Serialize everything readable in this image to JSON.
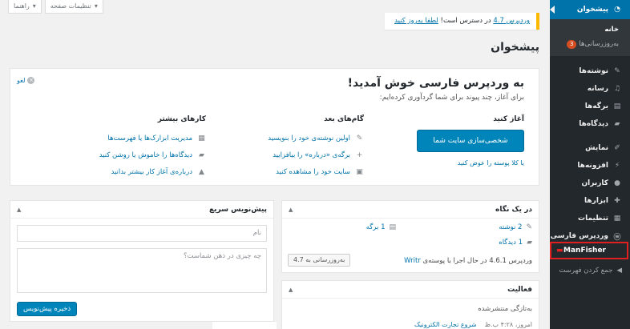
{
  "menu": {
    "dashboard": "پیشخوان",
    "home": "خانه",
    "updates": "به‌روزرسانی‌ها",
    "updates_count": "3",
    "posts": "نوشته‌ها",
    "media": "رسانه",
    "pages": "برگه‌ها",
    "comments": "دیدگاه‌ها",
    "appearance": "نمایش",
    "plugins": "افزونه‌ها",
    "users": "کاربران",
    "tools": "ابزارها",
    "settings": "تنظیمات",
    "persian": "وردپرس فارسی",
    "manfisher": "ManFisher",
    "collapse": "جمع کردن فهرست"
  },
  "tabs": {
    "screen_options": "تنظیمات صفحه",
    "help": "راهنما"
  },
  "notice": {
    "link1": "وردپرس 4.7",
    "text": " در دسترس است! ",
    "link2": "لطفا به‌روز کنید"
  },
  "page_title": "پیشخوان",
  "welcome": {
    "title": "به وردپرس فارسی خوش آمدید!",
    "subtitle": "برای آغاز، چند پیوند برای شما گردآوری کرده‌ایم:",
    "dismiss": "لغو",
    "start_title": "آغاز کنید",
    "customize_btn": "شخصی‌سازی سایت شما",
    "or_change": "یا کلا پوسته را عوض کنید",
    "next_title": "گام‌های بعد",
    "next": [
      "اولین نوشته‌ی خود را بنویسید",
      "برگه‌ی «درباره» را بیافزایید",
      "سایت خود را مشاهده کنید"
    ],
    "more_title": "کارهای بیشتر",
    "more": [
      "مدیریت ابزارک‌ها یا فهرست‌ها",
      "دیدگاه‌ها را خاموش یا روشن کنید",
      "درباره‌ی آغاز کار بیشتر بدانید"
    ]
  },
  "glance": {
    "title": "در یک نگاه",
    "posts": "2 نوشته",
    "pages": "1 برگه",
    "comments": "1 دیدگاه",
    "footer_text": "وردپرس 4.6.1 در حال اجرا با پوسته‌ی ",
    "theme": "Writr",
    "update_btn": "به‌روزرسانی به 4.7"
  },
  "draft": {
    "title": "پیش‌نویس سریع",
    "title_placeholder": "نام",
    "content_placeholder": "چه چیزی در ذهن شماست؟",
    "save": "ذخیره پیش‌نویس"
  },
  "activity": {
    "title": "فعالیت",
    "recent": "به‌تازگی منتشرشده",
    "date": "امروز، ۴:۲۸ ب.ظ",
    "post": "شروع تجارت الکترونیک"
  }
}
